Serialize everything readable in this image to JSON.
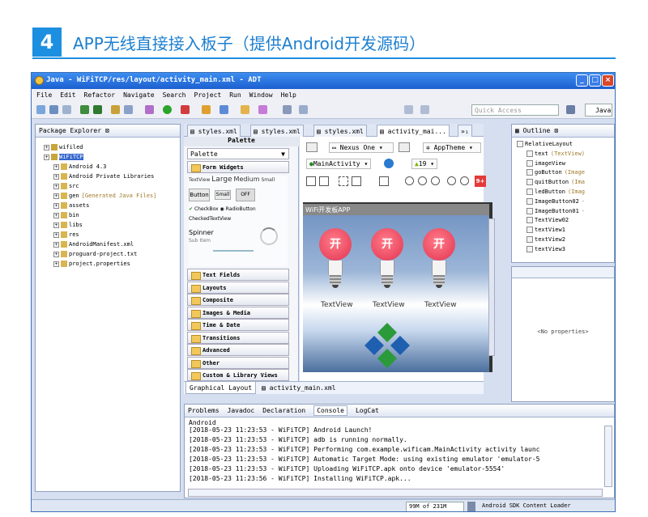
{
  "header": {
    "step_number": "4",
    "title": "APP无线直接接入板子（提供Android开发源码）"
  },
  "window": {
    "title": "Java - WiFiTCP/res/layout/activity_main.xml - ADT"
  },
  "menu": [
    "File",
    "Edit",
    "Refactor",
    "Navigate",
    "Search",
    "Project",
    "Run",
    "Window",
    "Help"
  ],
  "toolbar": {
    "quick_access_placeholder": "Quick Access",
    "perspective": "Java"
  },
  "package_explorer": {
    "tab": "Package Explorer",
    "items": [
      {
        "label": "wifiled",
        "indent": 0
      },
      {
        "label": "WiFiTCP",
        "indent": 0
      },
      {
        "label": "Android 4.3",
        "indent": 1
      },
      {
        "label": "Android Private Libraries",
        "indent": 1
      },
      {
        "label": "src",
        "indent": 1
      },
      {
        "label": "gen",
        "indent": 1,
        "note": "[Generated Java Files]"
      },
      {
        "label": "assets",
        "indent": 1
      },
      {
        "label": "bin",
        "indent": 1
      },
      {
        "label": "libs",
        "indent": 1
      },
      {
        "label": "res",
        "indent": 1
      },
      {
        "label": "AndroidManifest.xml",
        "indent": 1
      },
      {
        "label": "proguard-project.txt",
        "indent": 1
      },
      {
        "label": "project.properties",
        "indent": 1
      }
    ]
  },
  "editor_tabs": [
    "styles.xml",
    "styles.xml",
    "styles.xml",
    "activity_mai...",
    "»₁"
  ],
  "palette": {
    "title": "Palette",
    "dropdown": "Palette",
    "open_group": "Form Widgets",
    "widgets": {
      "text_sizes": [
        "TextView",
        "Large",
        "Medium",
        "Small"
      ],
      "buttons": [
        "Button",
        "Small",
        "OFF"
      ],
      "checkbox": "CheckBox",
      "radio": "RadioButton",
      "checked_text": "CheckedTextView",
      "spinner": "Spinner",
      "spinner_sub": "Sub Item"
    },
    "groups": [
      "Text Fields",
      "Layouts",
      "Composite",
      "Images & Media",
      "Time & Date",
      "Transitions",
      "Advanced",
      "Other",
      "Custom & Library Views"
    ]
  },
  "layout_toolbar": {
    "device": "Nexus One",
    "theme": "AppTheme",
    "activity": "MainActivity",
    "api": "19"
  },
  "device_screen": {
    "app_title": "WiFi开发板APP",
    "button_text": [
      "开",
      "开",
      "开"
    ],
    "text_views": [
      "TextView",
      "TextView",
      "TextView"
    ]
  },
  "editor_bottom_tabs": [
    "Graphical Layout",
    "activity_main.xml"
  ],
  "outline": {
    "tab": "Outline",
    "items": [
      {
        "label": "RelativeLayout",
        "detail": ""
      },
      {
        "label": "text",
        "detail": "(TextView)"
      },
      {
        "label": "imageView",
        "detail": ""
      },
      {
        "label": "goButton",
        "detail": "(Image"
      },
      {
        "label": "quitButton",
        "detail": "(Ima"
      },
      {
        "label": "ledButton",
        "detail": "(Imag"
      },
      {
        "label": "ImageButton02",
        "detail": "-"
      },
      {
        "label": "ImageButton01",
        "detail": "-"
      },
      {
        "label": "TextView02",
        "detail": ""
      },
      {
        "label": "textView1",
        "detail": ""
      },
      {
        "label": "textView2",
        "detail": ""
      },
      {
        "label": "textView3",
        "detail": ""
      }
    ]
  },
  "properties": {
    "empty_text": "<No properties>"
  },
  "console": {
    "tabs": [
      "Problems",
      "Javadoc",
      "Declaration",
      "Console",
      "LogCat"
    ],
    "active_tab": "Console",
    "header": "Android",
    "lines": [
      "[2018-05-23 11:23:53 - WiFiTCP] Android Launch!",
      "[2018-05-23 11:23:53 - WiFiTCP] adb is running normally.",
      "[2018-05-23 11:23:53 - WiFiTCP] Performing com.example.wificam.MainActivity activity launc",
      "[2018-05-23 11:23:53 - WiFiTCP] Automatic Target Mode: using existing emulator 'emulator-5",
      "[2018-05-23 11:23:53 - WiFiTCP] Uploading WiFiTCP.apk onto device 'emulator-5554'",
      "[2018-05-23 11:23:56 - WiFiTCP] Installing WiFiTCP.apk..."
    ]
  },
  "statusbar": {
    "memory": "99M of 231M",
    "task": "Android SDK Content Loader"
  },
  "colors": {
    "accent": "#1d8fe0",
    "titlebar": "#1c5fd0",
    "bulb": "#e2334f",
    "ide_bg": "#d6dff0"
  }
}
